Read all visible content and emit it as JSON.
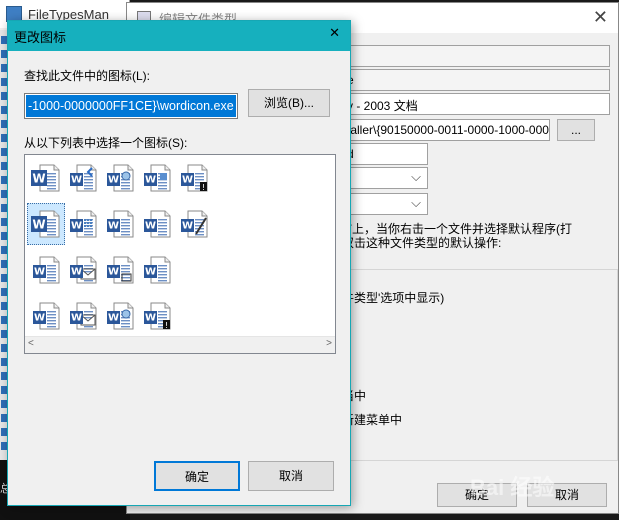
{
  "background_app": {
    "title": "FileTypesMan",
    "bottom_glyph": "总"
  },
  "edit_dialog": {
    "title": "编辑文件类型",
    "close": "✕",
    "field_name": "e",
    "field_desc": "y - 2003 文档",
    "field_path": "taller\\{90150000-0011-0000-1000-0000(",
    "field_small": "d",
    "browse_small": "...",
    "text_line1": "/7上，当你右击一个文件并选择默认程序(打",
    "text_line2": "双击这种文件类型的默认操作:",
    "option_show": "牛类型'选项中显示)",
    "option_2": "当中",
    "option_3": "新建菜单中",
    "ok": "确定",
    "cancel": "取消"
  },
  "change_icon_dialog": {
    "title": "更改图标",
    "close": "✕",
    "find_label": "查找此文件中的图标(L):",
    "path_value": "-1000-0000000FF1CE}\\wordicon.exe",
    "browse_button": "浏览(B)...",
    "list_label": "从以下列表中选择一个图标(S):",
    "ok_button": "确定",
    "cancel_button": "取消",
    "scroll_left": "<",
    "scroll_right": ">",
    "icons": [
      {
        "type": "word-icon",
        "variant": "w-only"
      },
      {
        "type": "word-doc-icon",
        "variant": "arrow"
      },
      {
        "type": "word-doc-icon",
        "variant": "globe"
      },
      {
        "type": "word-doc-icon",
        "variant": "puzzle"
      },
      {
        "type": "word-doc-icon",
        "variant": "warning"
      },
      {
        "type": "word-doc-icon",
        "variant": "big-selected"
      },
      {
        "type": "word-doc-icon",
        "variant": "grid"
      },
      {
        "type": "word-doc-icon",
        "variant": "layout"
      },
      {
        "type": "word-doc-icon",
        "variant": "doc"
      },
      {
        "type": "word-doc-icon",
        "variant": "pen"
      },
      {
        "type": "word-doc-icon",
        "variant": "template"
      },
      {
        "type": "word-doc-icon",
        "variant": "mail"
      },
      {
        "type": "word-doc-icon",
        "variant": "frame"
      },
      {
        "type": "word-doc-icon",
        "variant": "list"
      },
      {
        "type": "word-doc-icon",
        "variant": "ruler"
      },
      {
        "type": "word-doc-icon",
        "variant": "envelope"
      },
      {
        "type": "word-doc-icon",
        "variant": "web"
      },
      {
        "type": "word-doc-icon",
        "variant": "warning2"
      }
    ]
  },
  "colors": {
    "title_accent": "#16b0be",
    "selection": "#0078d7",
    "word_blue": "#2b579a"
  },
  "watermark": "Bai 经验"
}
